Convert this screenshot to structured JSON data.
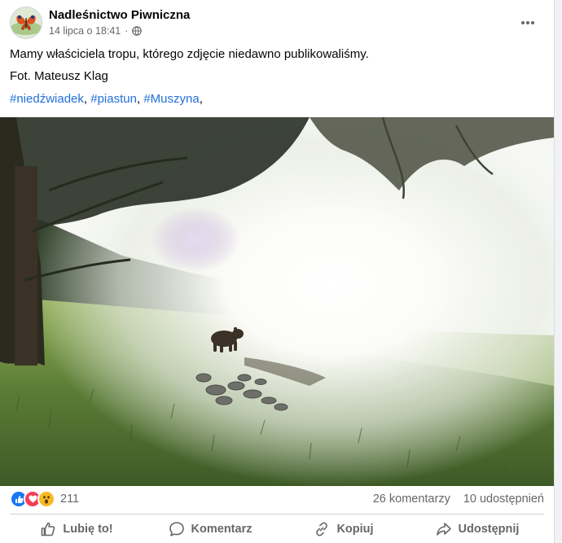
{
  "post": {
    "author": "Nadleśnictwo Piwniczna",
    "timestamp": "14 lipca o 18:41",
    "separator": "·",
    "audience_icon": "globe-icon",
    "menu_icon": "more-dots-icon",
    "text_line1": "Mamy właściciela tropu, którego zdjęcie niedawno publikowaliśmy.",
    "text_line2": "Fot. Mateusz Klag",
    "hashtags": [
      "#niedźwiadek",
      "#piastun",
      "#Muszyna"
    ],
    "hashtag_sep": ", ",
    "hashtag_trailing": ",",
    "photo_subject": "bear-on-meadow-photo"
  },
  "stats": {
    "reaction_icons": [
      "like-icon",
      "love-icon",
      "wow-icon"
    ],
    "reaction_count": "211",
    "comments": "26 komentarzy",
    "shares": "10 udostępnień"
  },
  "actions": {
    "like": "Lubię to!",
    "comment": "Komentarz",
    "copy": "Kopiuj",
    "share": "Udostępnij"
  },
  "colors": {
    "link": "#216fdb",
    "like": "#1877f2",
    "love": "#f33e58",
    "wow": "#f7b928",
    "secondary_text": "#65676b"
  }
}
